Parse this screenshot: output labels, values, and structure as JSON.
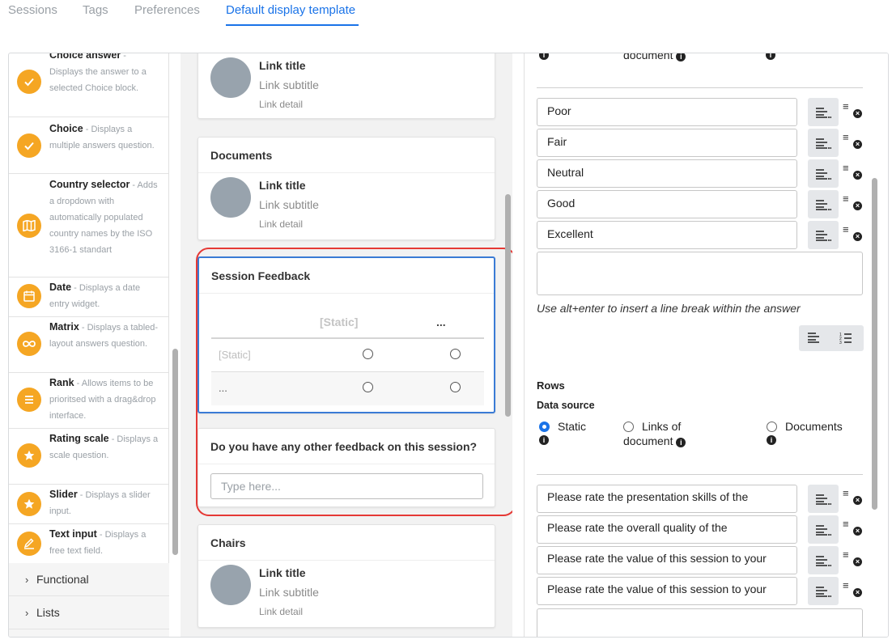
{
  "tabs": [
    {
      "label": "Sessions"
    },
    {
      "label": "Tags"
    },
    {
      "label": "Preferences"
    },
    {
      "label": "Default display template",
      "active": true
    }
  ],
  "palette": {
    "items": [
      {
        "name": "Choice answer",
        "desc": "Displays the answer to a selected Choice block.",
        "icon": "check-icon"
      },
      {
        "name": "Choice",
        "desc": "Displays a multiple answers question.",
        "icon": "check-icon"
      },
      {
        "name": "Country selector",
        "desc": "Adds a dropdown with automatically populated country names by the ISO 3166-1 standart",
        "icon": "map-icon"
      },
      {
        "name": "Date",
        "desc": "Displays a date entry widget.",
        "icon": "calendar-icon"
      },
      {
        "name": "Matrix",
        "desc": "Displays a tabled-layout answers question.",
        "icon": "infinity-icon"
      },
      {
        "name": "Rank",
        "desc": "Allows items to be prioritsed with a drag&drop interface.",
        "icon": "lines-icon"
      },
      {
        "name": "Rating scale",
        "desc": "Displays a scale question.",
        "icon": "star-icon"
      },
      {
        "name": "Slider",
        "desc": "Displays a slider input.",
        "icon": "star-icon"
      },
      {
        "name": "Text input",
        "desc": "Displays a free text field.",
        "icon": "edit-icon"
      }
    ],
    "groups": [
      {
        "label": "Functional"
      },
      {
        "label": "Lists"
      }
    ]
  },
  "middle": {
    "link_card": {
      "title": "Link title",
      "subtitle": "Link subtitle",
      "detail": "Link detail"
    },
    "documents_title": "Documents",
    "session_feedback": {
      "title": "Session Feedback",
      "col_headers": [
        "[Static]",
        "..."
      ],
      "rows": [
        "[Static]",
        "..."
      ]
    },
    "other_feedback": {
      "question": "Do you have any other feedback on this session?",
      "placeholder": "Type here..."
    },
    "chairs_title": "Chairs"
  },
  "right": {
    "top_partial": {
      "document_label": "document"
    },
    "answers": [
      "Poor",
      "Fair",
      "Neutral",
      "Good",
      "Excellent"
    ],
    "hint": "Use alt+enter to insert a line break within the answer",
    "rows_label": "Rows",
    "data_source_label": "Data source",
    "data_source_options": [
      {
        "label": "Static",
        "selected": true
      },
      {
        "label": "Links of",
        "second_line": "document"
      },
      {
        "label": "Documents"
      }
    ],
    "row_answers": [
      "Please rate the presentation skills of the",
      "Please rate the overall quality of the",
      "Please rate the value of this session to your",
      "Please rate the value of this session to your"
    ]
  },
  "colors": {
    "accent": "#1a73e8",
    "icon_orange": "#f5a623",
    "highlight_red": "#e53935",
    "selected_blue": "#3a7bd5"
  }
}
